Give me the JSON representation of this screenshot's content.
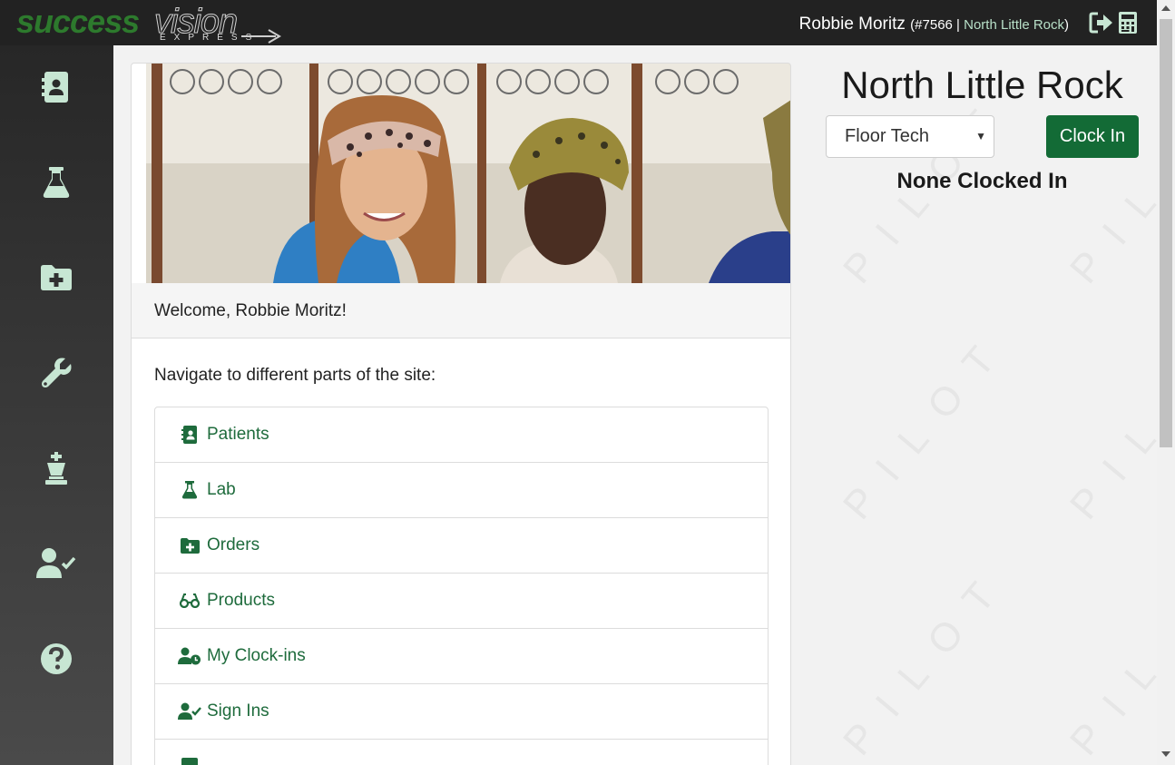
{
  "brand": {
    "word1": "success",
    "word2": "vision",
    "word3": "EXPRESS"
  },
  "header": {
    "user_name": "Robbie Moritz",
    "user_id": "(#7566",
    "separator": " | ",
    "location": "North Little Rock",
    "close_paren": ")",
    "icons": [
      "sign-out-icon",
      "calculator-icon"
    ]
  },
  "sidebar": {
    "items": [
      {
        "icon": "patients-icon"
      },
      {
        "icon": "lab-flask-icon"
      },
      {
        "icon": "orders-folder-icon"
      },
      {
        "icon": "wrench-icon"
      },
      {
        "icon": "chess-king-icon"
      },
      {
        "icon": "user-check-icon"
      },
      {
        "icon": "help-icon"
      }
    ]
  },
  "main": {
    "welcome": "Welcome, Robbie Moritz!",
    "nav_title": "Navigate to different parts of the site:",
    "nav_items": [
      {
        "label": "Patients",
        "icon": "patients-icon"
      },
      {
        "label": "Lab",
        "icon": "lab-flask-icon"
      },
      {
        "label": "Orders",
        "icon": "orders-folder-icon"
      },
      {
        "label": "Products",
        "icon": "glasses-icon"
      },
      {
        "label": "My Clock-ins",
        "icon": "user-clock-icon"
      },
      {
        "label": "Sign Ins",
        "icon": "user-check-icon"
      }
    ]
  },
  "clock_panel": {
    "location_title": "North Little Rock",
    "role_selected": "Floor Tech",
    "clock_in_label": "Clock In",
    "status": "None Clocked In",
    "watermark": "PILOT"
  },
  "colors": {
    "accent": "#136b36",
    "link": "#1e6b3c",
    "topbar": "#222222"
  }
}
